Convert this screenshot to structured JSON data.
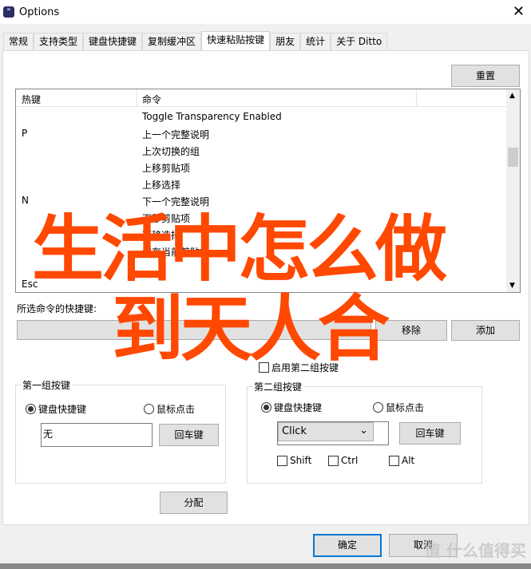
{
  "window": {
    "title": "Options",
    "icon": "ditto-app-icon"
  },
  "tabs": [
    {
      "label": "常规"
    },
    {
      "label": "支持类型"
    },
    {
      "label": "键盘快捷键"
    },
    {
      "label": "复制缓冲区"
    },
    {
      "label": "快速粘贴按键",
      "active": true
    },
    {
      "label": "朋友"
    },
    {
      "label": "统计"
    },
    {
      "label": "关于 Ditto"
    }
  ],
  "reset_label": "重置",
  "list": {
    "headers": [
      "热键",
      "命令"
    ],
    "rows": [
      {
        "key": "",
        "cmd": "Toggle Transparency Enabled"
      },
      {
        "key": "P",
        "cmd": "上一个完整说明"
      },
      {
        "key": "",
        "cmd": "上次切换的组"
      },
      {
        "key": "",
        "cmd": "上移剪贴项"
      },
      {
        "key": "",
        "cmd": "上移选择"
      },
      {
        "key": "N",
        "cmd": "下一个完整说明"
      },
      {
        "key": "",
        "cmd": "下移剪贴项"
      },
      {
        "key": "",
        "cmd": "下移选择"
      },
      {
        "key": "",
        "cmd": "保存当前剪贴板"
      },
      {
        "key": "",
        "cmd": ""
      },
      {
        "key": "Esc",
        "cmd": ""
      }
    ]
  },
  "selected_hotkey_label": "所选命令的快捷键:",
  "remove_label": "移除",
  "add_label": "添加",
  "enable_second_label": "启用第二组按键",
  "group1": {
    "title": "第一组按键",
    "radio_keyboard": "键盘快捷键",
    "radio_mouse": "鼠标点击",
    "value": "无",
    "enter_label": "回车键"
  },
  "group2": {
    "title": "第二组按键",
    "radio_keyboard": "键盘快捷键",
    "radio_mouse": "鼠标点击",
    "select_value": "Click",
    "enter_label": "回车键",
    "shift": "Shift",
    "ctrl": "Ctrl",
    "alt": "Alt"
  },
  "assign_label": "分配",
  "ok_label": "确定",
  "cancel_label": "取消",
  "overlay": {
    "line1": "生活中怎么做",
    "line2": "到天人合",
    "color": "#ff4800"
  },
  "watermark": "值 什么值得买"
}
